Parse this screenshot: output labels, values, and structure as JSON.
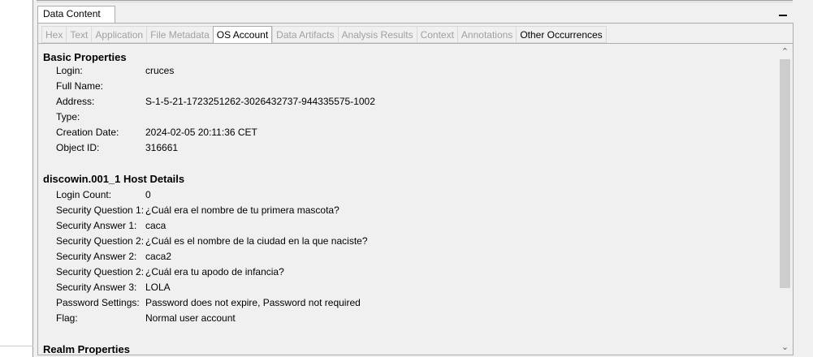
{
  "outer_tab": {
    "label": "Data Content"
  },
  "tabs": [
    {
      "label": "Hex",
      "enabled": false,
      "active": false
    },
    {
      "label": "Text",
      "enabled": false,
      "active": false
    },
    {
      "label": "Application",
      "enabled": false,
      "active": false
    },
    {
      "label": "File Metadata",
      "enabled": false,
      "active": false
    },
    {
      "label": "OS Account",
      "enabled": true,
      "active": true
    },
    {
      "label": "Data Artifacts",
      "enabled": false,
      "active": false
    },
    {
      "label": "Analysis Results",
      "enabled": false,
      "active": false
    },
    {
      "label": "Context",
      "enabled": false,
      "active": false
    },
    {
      "label": "Annotations",
      "enabled": false,
      "active": false
    },
    {
      "label": "Other Occurrences",
      "enabled": true,
      "active": false
    }
  ],
  "basic": {
    "title": "Basic Properties",
    "rows": [
      {
        "label": "Login:",
        "value": "cruces"
      },
      {
        "label": "Full Name:",
        "value": ""
      },
      {
        "label": "Address:",
        "value": "S-1-5-21-1723251262-3026432737-944335575-1002"
      },
      {
        "label": "Type:",
        "value": ""
      },
      {
        "label": "Creation Date:",
        "value": "2024-02-05 20:11:36 CET"
      },
      {
        "label": "Object ID:",
        "value": "316661"
      }
    ]
  },
  "host": {
    "title": "discowin.001_1 Host Details",
    "rows": [
      {
        "label": "Login Count:",
        "value": "0"
      },
      {
        "label": "Security Question 1:",
        "value": "¿Cuál era el nombre de tu primera mascota?"
      },
      {
        "label": "Security Answer 1:",
        "value": "caca"
      },
      {
        "label": "Security Question 2:",
        "value": "¿Cuál es el nombre de la ciudad en la que naciste?"
      },
      {
        "label": "Security Answer 2:",
        "value": "caca2"
      },
      {
        "label": "Security Question 2:",
        "value": "¿Cuál era tu apodo de infancia?"
      },
      {
        "label": "Security Answer 3:",
        "value": "LOLA"
      },
      {
        "label": "Password Settings:",
        "value": "Password does not expire, Password not required"
      },
      {
        "label": "Flag:",
        "value": "Normal user account"
      }
    ]
  },
  "realm": {
    "title": "Realm Properties"
  },
  "scrollbar": {
    "up_icon": "chevron-up-icon",
    "down_icon": "chevron-down-icon"
  }
}
